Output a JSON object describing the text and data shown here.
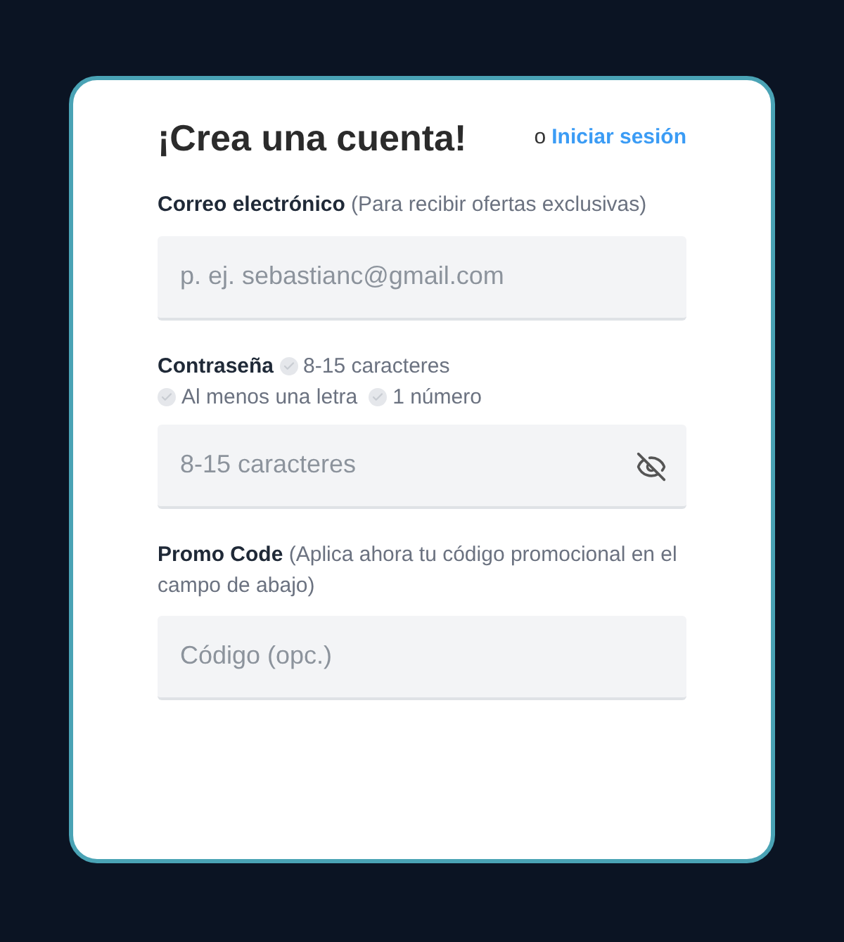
{
  "title": "¡Crea una cuenta!",
  "login": {
    "prefix": "o",
    "link": "Iniciar sesión"
  },
  "email": {
    "label": "Correo electrónico",
    "hint": "(Para recibir ofertas exclusivas)",
    "placeholder": "p. ej. sebastianc@gmail.com"
  },
  "password": {
    "label": "Contraseña",
    "placeholder": "8-15 caracteres",
    "visible": false,
    "rules": [
      {
        "text": "8-15 caracteres",
        "met": false
      },
      {
        "text": "Al menos una letra",
        "met": false
      },
      {
        "text": "1 número",
        "met": false
      }
    ]
  },
  "promo": {
    "label": "Promo Code",
    "hint": "(Aplica ahora tu código promocional en el campo de abajo)",
    "placeholder": "Código (opc.)"
  }
}
